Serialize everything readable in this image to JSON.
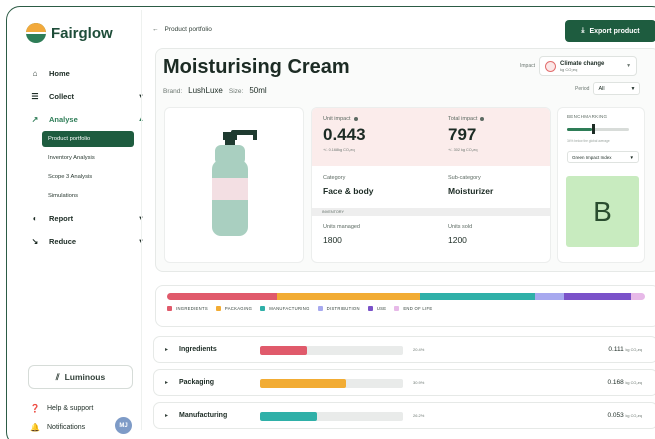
{
  "app": {
    "brand": "Fairglow"
  },
  "sidebar": {
    "items": [
      {
        "label": "Home",
        "icon": "home-icon"
      },
      {
        "label": "Collect",
        "icon": "collect-icon"
      },
      {
        "label": "Analyse",
        "icon": "analyse-icon"
      },
      {
        "label": "Report",
        "icon": "report-icon"
      },
      {
        "label": "Reduce",
        "icon": "reduce-icon"
      }
    ],
    "sub_items": [
      "Product portfolio",
      "Inventory Analysis",
      "Scope 3 Analysis",
      "Simulations"
    ],
    "partner": "Luminous",
    "help": "Help & support",
    "notifications": "Notifications",
    "avatar_initials": "MJ"
  },
  "header": {
    "breadcrumb": "Product portfolio",
    "export_label": "Export product"
  },
  "product": {
    "title": "Moisturising Cream",
    "brand_label": "Brand:",
    "brand": "LushLuxe",
    "size_label": "Size:",
    "size": "50ml"
  },
  "impact_selector": {
    "label": "Impact",
    "value": "Climate change",
    "unit": "kg CO₂eq"
  },
  "period": {
    "label": "Period",
    "value": "All"
  },
  "stats": {
    "unit_impact_label": "Unit impact",
    "unit_impact_value": "0.443",
    "unit_impact_sub": "+/- 0.168kg CO₂eq",
    "total_impact_label": "Total impact",
    "total_impact_value": "797",
    "total_impact_sub": "+/- 302 kg CO₂eq",
    "category_label": "Category",
    "category_value": "Face & body",
    "subcategory_label": "Sub-category",
    "subcategory_value": "Moisturizer",
    "inventory_label": "INVENTORY",
    "units_managed_label": "Units managed",
    "units_managed_value": "1800",
    "units_sold_label": "Units sold",
    "units_sold_value": "1200"
  },
  "benchmarking": {
    "title": "BENCHMARKING",
    "position": 0.4,
    "note": "34% below the global average",
    "selector": "Green Impact Index",
    "grade": "B"
  },
  "chart_data": {
    "type": "bar",
    "stacked": true,
    "categories": [
      "INGREDIENTS",
      "PACKAGING",
      "MANUFACTURING",
      "DISTRIBUTION",
      "USE",
      "END OF LIFE"
    ],
    "values": [
      23,
      30,
      24,
      6,
      14,
      3
    ],
    "colors": [
      "#e05a6b",
      "#f2ac34",
      "#2fb0a8",
      "#a7a9ef",
      "#7a52c9",
      "#e7b9e8"
    ]
  },
  "breakdown": [
    {
      "name": "Ingredients",
      "pct": "20.4%",
      "fraction": 0.33,
      "kg": "0.111",
      "unit": "kg CO₂eq",
      "color": "#e05a6b"
    },
    {
      "name": "Packaging",
      "pct": "30.9%",
      "fraction": 0.6,
      "kg": "0.168",
      "unit": "kg CO₂eq",
      "color": "#f2ac34"
    },
    {
      "name": "Manufacturing",
      "pct": "26.2%",
      "fraction": 0.4,
      "kg": "0.053",
      "unit": "kg CO₂eq",
      "color": "#2fb0a8"
    }
  ]
}
